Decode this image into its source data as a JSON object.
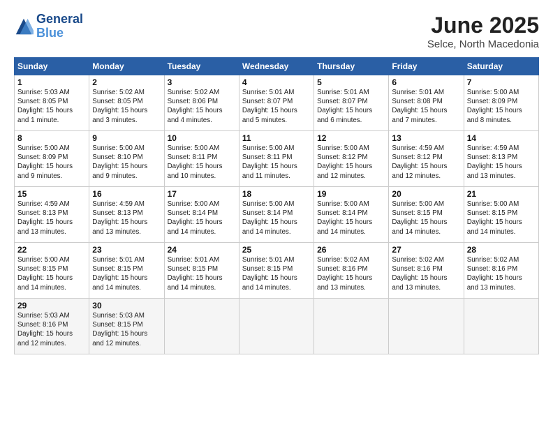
{
  "header": {
    "logo_line1": "General",
    "logo_line2": "Blue",
    "title": "June 2025",
    "subtitle": "Selce, North Macedonia"
  },
  "weekdays": [
    "Sunday",
    "Monday",
    "Tuesday",
    "Wednesday",
    "Thursday",
    "Friday",
    "Saturday"
  ],
  "weeks": [
    [
      {
        "day": 1,
        "lines": [
          "Sunrise: 5:03 AM",
          "Sunset: 8:05 PM",
          "Daylight: 15 hours",
          "and 1 minute."
        ]
      },
      {
        "day": 2,
        "lines": [
          "Sunrise: 5:02 AM",
          "Sunset: 8:05 PM",
          "Daylight: 15 hours",
          "and 3 minutes."
        ]
      },
      {
        "day": 3,
        "lines": [
          "Sunrise: 5:02 AM",
          "Sunset: 8:06 PM",
          "Daylight: 15 hours",
          "and 4 minutes."
        ]
      },
      {
        "day": 4,
        "lines": [
          "Sunrise: 5:01 AM",
          "Sunset: 8:07 PM",
          "Daylight: 15 hours",
          "and 5 minutes."
        ]
      },
      {
        "day": 5,
        "lines": [
          "Sunrise: 5:01 AM",
          "Sunset: 8:07 PM",
          "Daylight: 15 hours",
          "and 6 minutes."
        ]
      },
      {
        "day": 6,
        "lines": [
          "Sunrise: 5:01 AM",
          "Sunset: 8:08 PM",
          "Daylight: 15 hours",
          "and 7 minutes."
        ]
      },
      {
        "day": 7,
        "lines": [
          "Sunrise: 5:00 AM",
          "Sunset: 8:09 PM",
          "Daylight: 15 hours",
          "and 8 minutes."
        ]
      }
    ],
    [
      {
        "day": 8,
        "lines": [
          "Sunrise: 5:00 AM",
          "Sunset: 8:09 PM",
          "Daylight: 15 hours",
          "and 9 minutes."
        ]
      },
      {
        "day": 9,
        "lines": [
          "Sunrise: 5:00 AM",
          "Sunset: 8:10 PM",
          "Daylight: 15 hours",
          "and 9 minutes."
        ]
      },
      {
        "day": 10,
        "lines": [
          "Sunrise: 5:00 AM",
          "Sunset: 8:11 PM",
          "Daylight: 15 hours",
          "and 10 minutes."
        ]
      },
      {
        "day": 11,
        "lines": [
          "Sunrise: 5:00 AM",
          "Sunset: 8:11 PM",
          "Daylight: 15 hours",
          "and 11 minutes."
        ]
      },
      {
        "day": 12,
        "lines": [
          "Sunrise: 5:00 AM",
          "Sunset: 8:12 PM",
          "Daylight: 15 hours",
          "and 12 minutes."
        ]
      },
      {
        "day": 13,
        "lines": [
          "Sunrise: 4:59 AM",
          "Sunset: 8:12 PM",
          "Daylight: 15 hours",
          "and 12 minutes."
        ]
      },
      {
        "day": 14,
        "lines": [
          "Sunrise: 4:59 AM",
          "Sunset: 8:13 PM",
          "Daylight: 15 hours",
          "and 13 minutes."
        ]
      }
    ],
    [
      {
        "day": 15,
        "lines": [
          "Sunrise: 4:59 AM",
          "Sunset: 8:13 PM",
          "Daylight: 15 hours",
          "and 13 minutes."
        ]
      },
      {
        "day": 16,
        "lines": [
          "Sunrise: 4:59 AM",
          "Sunset: 8:13 PM",
          "Daylight: 15 hours",
          "and 13 minutes."
        ]
      },
      {
        "day": 17,
        "lines": [
          "Sunrise: 5:00 AM",
          "Sunset: 8:14 PM",
          "Daylight: 15 hours",
          "and 14 minutes."
        ]
      },
      {
        "day": 18,
        "lines": [
          "Sunrise: 5:00 AM",
          "Sunset: 8:14 PM",
          "Daylight: 15 hours",
          "and 14 minutes."
        ]
      },
      {
        "day": 19,
        "lines": [
          "Sunrise: 5:00 AM",
          "Sunset: 8:14 PM",
          "Daylight: 15 hours",
          "and 14 minutes."
        ]
      },
      {
        "day": 20,
        "lines": [
          "Sunrise: 5:00 AM",
          "Sunset: 8:15 PM",
          "Daylight: 15 hours",
          "and 14 minutes."
        ]
      },
      {
        "day": 21,
        "lines": [
          "Sunrise: 5:00 AM",
          "Sunset: 8:15 PM",
          "Daylight: 15 hours",
          "and 14 minutes."
        ]
      }
    ],
    [
      {
        "day": 22,
        "lines": [
          "Sunrise: 5:00 AM",
          "Sunset: 8:15 PM",
          "Daylight: 15 hours",
          "and 14 minutes."
        ]
      },
      {
        "day": 23,
        "lines": [
          "Sunrise: 5:01 AM",
          "Sunset: 8:15 PM",
          "Daylight: 15 hours",
          "and 14 minutes."
        ]
      },
      {
        "day": 24,
        "lines": [
          "Sunrise: 5:01 AM",
          "Sunset: 8:15 PM",
          "Daylight: 15 hours",
          "and 14 minutes."
        ]
      },
      {
        "day": 25,
        "lines": [
          "Sunrise: 5:01 AM",
          "Sunset: 8:15 PM",
          "Daylight: 15 hours",
          "and 14 minutes."
        ]
      },
      {
        "day": 26,
        "lines": [
          "Sunrise: 5:02 AM",
          "Sunset: 8:16 PM",
          "Daylight: 15 hours",
          "and 13 minutes."
        ]
      },
      {
        "day": 27,
        "lines": [
          "Sunrise: 5:02 AM",
          "Sunset: 8:16 PM",
          "Daylight: 15 hours",
          "and 13 minutes."
        ]
      },
      {
        "day": 28,
        "lines": [
          "Sunrise: 5:02 AM",
          "Sunset: 8:16 PM",
          "Daylight: 15 hours",
          "and 13 minutes."
        ]
      }
    ],
    [
      {
        "day": 29,
        "lines": [
          "Sunrise: 5:03 AM",
          "Sunset: 8:16 PM",
          "Daylight: 15 hours",
          "and 12 minutes."
        ]
      },
      {
        "day": 30,
        "lines": [
          "Sunrise: 5:03 AM",
          "Sunset: 8:15 PM",
          "Daylight: 15 hours",
          "and 12 minutes."
        ]
      },
      null,
      null,
      null,
      null,
      null
    ]
  ]
}
